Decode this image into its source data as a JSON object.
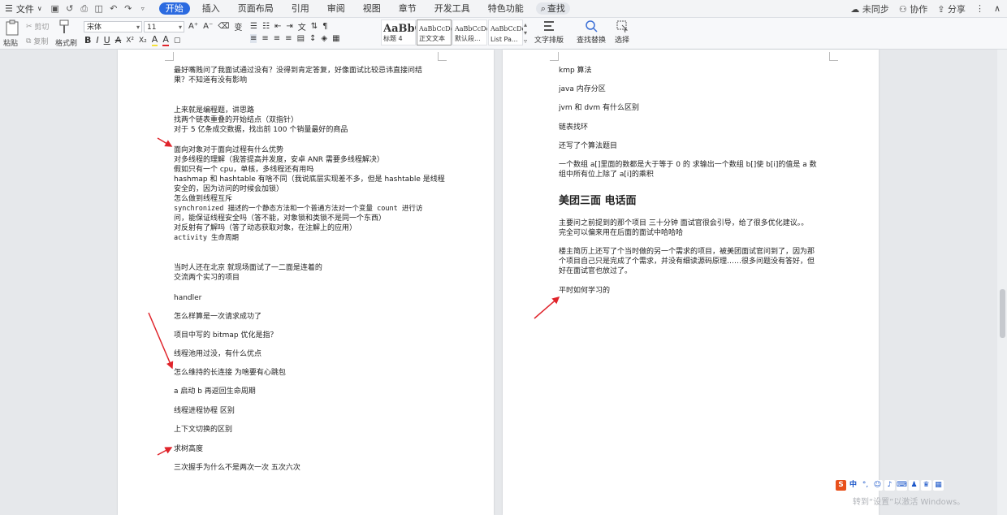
{
  "menu": {
    "file": "文件",
    "tabs": [
      "开始",
      "插入",
      "页面布局",
      "引用",
      "审阅",
      "视图",
      "章节",
      "开发工具",
      "特色功能"
    ],
    "active_tab": "开始",
    "search": "查找",
    "right": {
      "sync": "未同步",
      "collab": "协作",
      "share": "分享"
    }
  },
  "ribbon": {
    "paste": "粘贴",
    "cut": "剪切",
    "copy": "复制",
    "format_painter": "格式刷",
    "font_name": "宋体",
    "font_size": "11",
    "styles": [
      {
        "sample": "AaBbC",
        "label": "标题 4"
      },
      {
        "sample": "AaBbCcDd",
        "label": "正文文本"
      },
      {
        "sample": "AaBbCcDd",
        "label": "默认段..."
      },
      {
        "sample": "AaBbCcDd",
        "label": "List Pa..."
      }
    ],
    "text_layout": "文字排版",
    "find_replace": "查找替换",
    "select": "选择"
  },
  "page1": {
    "lines": [
      "最好嘴贱问了我面试通过没有？没得到肯定答复，好像面试比较忌讳直接问结",
      "果？不知道有没有影响",
      "上来就是编程题，讲思路",
      "找两个链表重叠的开始结点（双指针）",
      "对于 5 亿条成交数据，找出前 100 个销量最好的商品",
      "面向对象对于面向过程有什么优势",
      "对多线程的理解（我答提高并发度，安卓 ANR 需要多线程解决）",
      "假如只有一个 cpu，单核，多线程还有用吗",
      "hashmap 和 hashtable 有啥不同（我说底层实现差不多，但是 hashtable 是线程",
      "安全的，因为访问的时候会加锁）",
      "怎么做到线程互斥",
      "synchronized 描述的一个静态方法和一个普通方法对一个变量 count 进行访",
      "问，能保证线程安全吗（答不能，对象锁和类锁不是同一个东西）",
      "对反射有了解吗（答了动态获取对象，在注解上的应用）",
      "activity 生命周期",
      "当时人还在北京 就现场面试了一二面是连着的",
      "交流两个实习的项目",
      "handler",
      "怎么样算是一次请求成功了",
      "项目中写的 bitmap 优化是指？",
      "线程池用过没，有什么优点",
      "怎么维持的长连接 为啥要有心跳包",
      "a 启动 b 再返回生命周期",
      "线程进程协程 区别",
      "上下文切换的区别",
      "求树高度",
      "三次握手为什么不是两次一次 五次六次"
    ]
  },
  "page2": {
    "lines_top": [
      "kmp 算法",
      "java 内存分区",
      "jvm 和 dvm 有什么区别",
      "链表找环",
      "还写了个算法题目",
      "一个数组 a[]里面的数都是大于等于 0 的 求输出一个数组 b[]使 b[i]的值是 a 数",
      "组中所有位上除了 a[i]的乘积"
    ],
    "heading": "美团三面 电话面",
    "lines_bottom": [
      "主要问之前提到的那个项目 三十分钟 面试官很会引导，给了很多优化建议。。",
      "完全可以偏来用在后面的面试中哈哈哈",
      "楼主简历上还写了个当时做的另一个需求的项目，被美团面试官问到了，因为那",
      "个项目自己只是完成了个需求，并没有细读源码原理……很多问题没有答好，但",
      "好在面试官也放过了。",
      "平时如何学习的"
    ]
  },
  "watermark": "转到“设置”以激活 Windows。",
  "ime_label": "中",
  "colors": {
    "accent": "#2b6ae0",
    "arrow": "#e0242b"
  }
}
